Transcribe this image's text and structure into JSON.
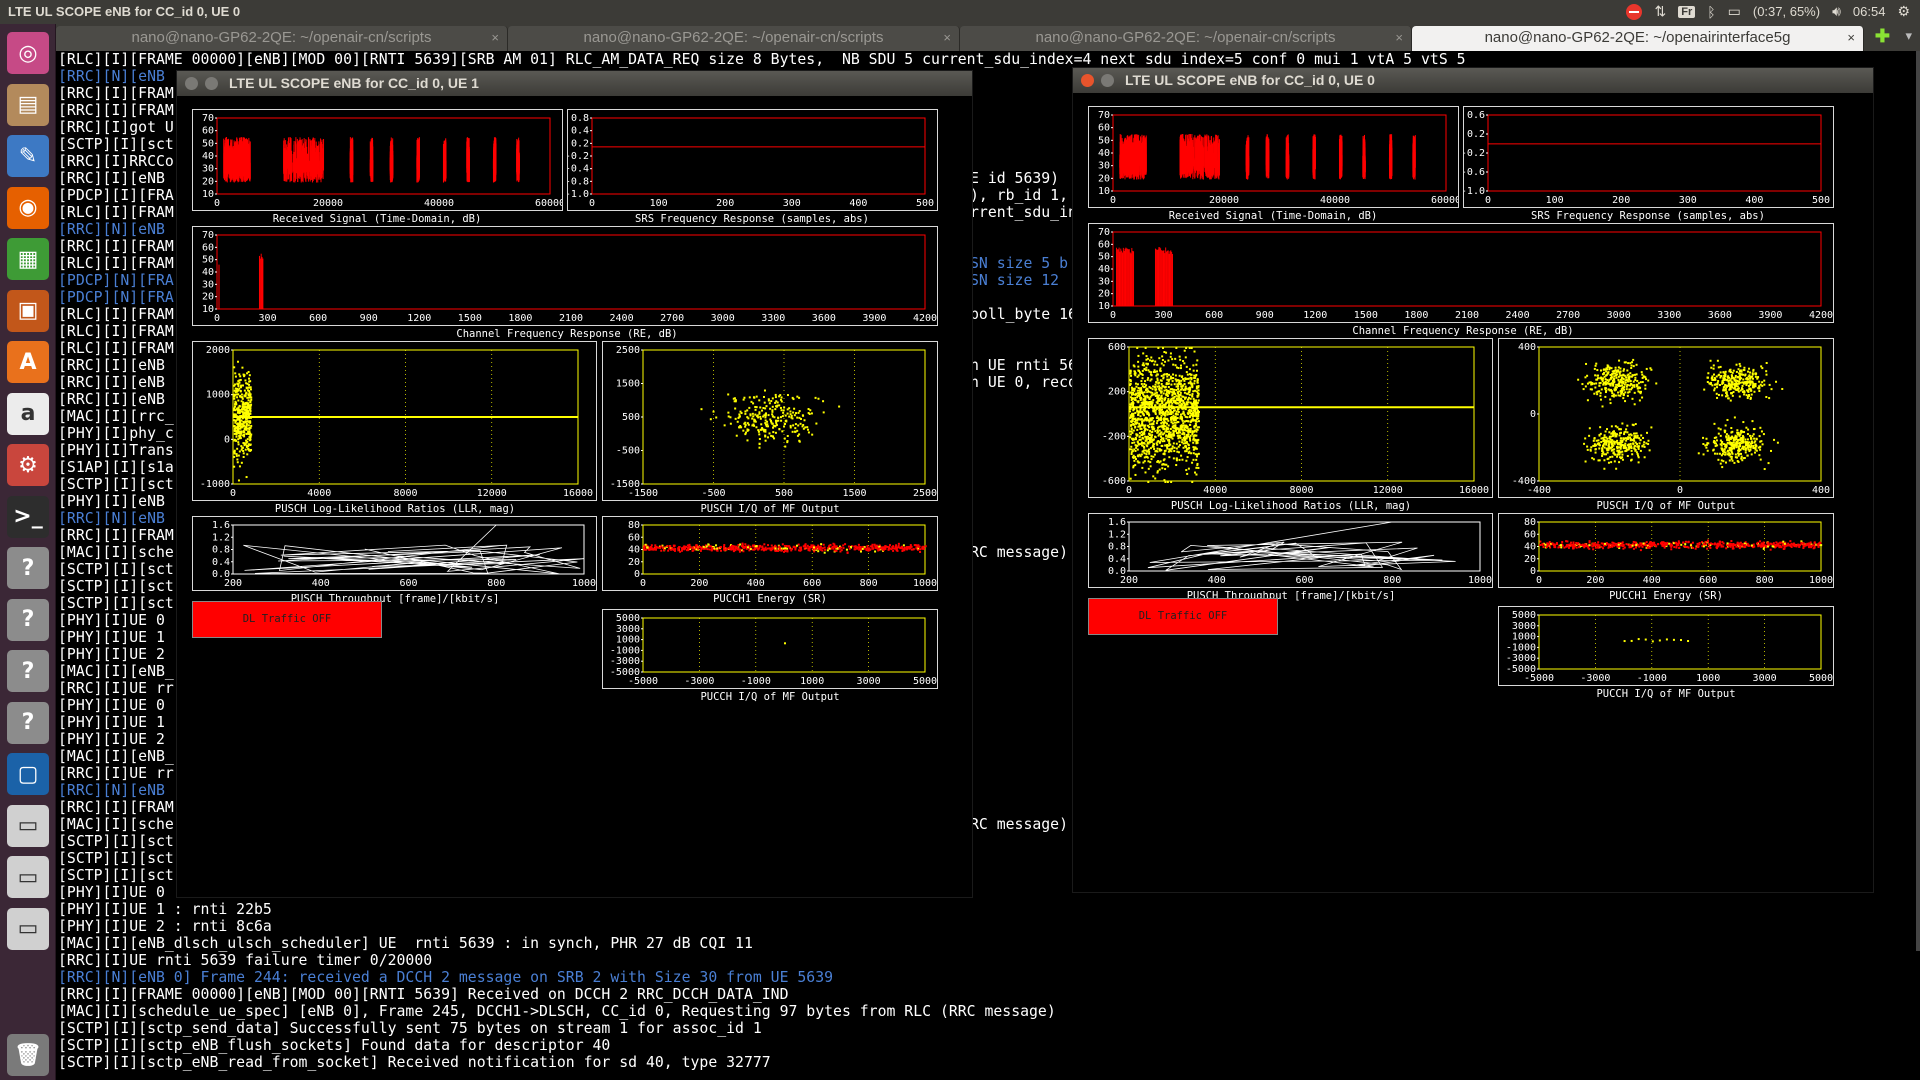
{
  "topbar": {
    "title": "LTE UL SCOPE eNB for CC_id 0, UE 0",
    "keyboard": "Fr",
    "battery": "(0:37, 65%)",
    "time": "06:54"
  },
  "launcher": {
    "items": [
      "ubuntu-dash",
      "file-manager",
      "text-editor",
      "firefox",
      "calc",
      "impress",
      "software-center",
      "amazon",
      "system-settings",
      "terminal",
      "unknown-app",
      "unknown-app",
      "unknown-app",
      "unknown-app",
      "virtualbox",
      "drive",
      "drive",
      "drive",
      "trash"
    ]
  },
  "tabs": [
    {
      "label": "nano@nano-GP62-2QE: ~/openair-cn/scripts",
      "active": false
    },
    {
      "label": "nano@nano-GP62-2QE: ~/openair-cn/scripts",
      "active": false
    },
    {
      "label": "nano@nano-GP62-2QE: ~/openair-cn/scripts",
      "active": false
    },
    {
      "label": "nano@nano-GP62-2QE: ~/openairinterface5g",
      "active": true
    }
  ],
  "terminal": {
    "lines": [
      {
        "t": "[RLC][I][FRAME 00000][eNB][MOD 00][RNTI 5639][SRB AM 01] RLC_AM_DATA_REQ size 8 Bytes,  NB SDU 5 current_sdu_index=4 next_sdu_index=5 conf 0 mui 1 vtA 5 vtS 5",
        "c": "w"
      },
      {
        "t": "[RRC][N][eNB",
        "c": "b"
      },
      {
        "t": "[RRC][I][FRAM",
        "c": "w"
      },
      {
        "t": "[RRC][I][FRAM",
        "c": "w"
      },
      {
        "t": "[RRC][I]got U",
        "c": "w"
      },
      {
        "t": "[SCTP][I][sct",
        "c": "w"
      },
      {
        "t": "[RRC][I]RRCCo",
        "c": "w"
      },
      {
        "t": "[RRC][I][eNB",
        "c": "w"
      },
      {
        "t": "[PDCP][I][FRA",
        "c": "w"
      },
      {
        "t": "[RLC][I][FRAM",
        "c": "w"
      },
      {
        "t": "[RRC][N][eNB",
        "c": "b"
      },
      {
        "t": "[RRC][I][FRAM",
        "c": "w"
      },
      {
        "t": "[RLC][I][FRAM",
        "c": "w"
      },
      {
        "t": "[PDCP][N][FRA",
        "c": "b"
      },
      {
        "t": "[PDCP][N][FRA",
        "c": "b"
      },
      {
        "t": "[RLC][I][FRAM",
        "c": "w"
      },
      {
        "t": "[RLC][I][FRAM",
        "c": "w"
      },
      {
        "t": "[RLC][I][FRAM",
        "c": "w"
      },
      {
        "t": "[RRC][I][eNB",
        "c": "w"
      },
      {
        "t": "[RRC][I][eNB",
        "c": "w"
      },
      {
        "t": "[RRC][I][eNB",
        "c": "w"
      },
      {
        "t": "[MAC][I][rrc_",
        "c": "w"
      },
      {
        "t": "[PHY][I]phy_c",
        "c": "w"
      },
      {
        "t": "[PHY][I]Trans",
        "c": "w"
      },
      {
        "t": "[S1AP][I][s1a",
        "c": "w"
      },
      {
        "t": "[SCTP][I][sct",
        "c": "w"
      },
      {
        "t": "[PHY][I][eNB",
        "c": "w"
      },
      {
        "t": "[RRC][N][eNB",
        "c": "b"
      },
      {
        "t": "[RRC][I][FRAM",
        "c": "w"
      },
      {
        "t": "[MAC][I][sche",
        "c": "w"
      },
      {
        "t": "[SCTP][I][sct",
        "c": "w"
      },
      {
        "t": "[SCTP][I][sct",
        "c": "w"
      },
      {
        "t": "[SCTP][I][sct",
        "c": "w"
      },
      {
        "t": "[PHY][I]UE 0",
        "c": "w"
      },
      {
        "t": "[PHY][I]UE 1",
        "c": "w"
      },
      {
        "t": "[PHY][I]UE 2",
        "c": "w"
      },
      {
        "t": "[MAC][I][eNB_",
        "c": "w"
      },
      {
        "t": "[RRC][I]UE rr",
        "c": "w"
      },
      {
        "t": "[PHY][I]UE 0",
        "c": "w"
      },
      {
        "t": "[PHY][I]UE 1",
        "c": "w"
      },
      {
        "t": "[PHY][I]UE 2",
        "c": "w"
      },
      {
        "t": "[MAC][I][eNB_",
        "c": "w"
      },
      {
        "t": "[RRC][I]UE rr",
        "c": "w"
      },
      {
        "t": "[RRC][N][eNB",
        "c": "b"
      },
      {
        "t": "[RRC][I][FRAM",
        "c": "w"
      },
      {
        "t": "[MAC][I][sche",
        "c": "w"
      },
      {
        "t": "[SCTP][I][sct",
        "c": "w"
      },
      {
        "t": "[SCTP][I][sct",
        "c": "w"
      },
      {
        "t": "[SCTP][I][sct",
        "c": "w"
      },
      {
        "t": "[PHY][I]UE 0 : rnti 5639",
        "c": "w"
      },
      {
        "t": "[PHY][I]UE 1 : rnti 22b5",
        "c": "w"
      },
      {
        "t": "[PHY][I]UE 2 : rnti 8c6a",
        "c": "w"
      },
      {
        "t": "[MAC][I][eNB_dlsch_ulsch_scheduler] UE  rnti 5639 : in synch, PHR 27 dB CQI 11",
        "c": "w"
      },
      {
        "t": "[RRC][I]UE rnti 5639 failure timer 0/20000",
        "c": "w"
      },
      {
        "t": "[RRC][N][eNB 0] Frame 244: received a DCCH 2 message on SRB 2 with Size 30 from UE 5639",
        "c": "b"
      },
      {
        "t": "[RRC][I][FRAME 00000][eNB][MOD 00][RNTI 5639] Received on DCCH 2 RRC_DCCH_DATA_IND",
        "c": "w"
      },
      {
        "t": "[MAC][I][schedule_ue_spec] [eNB 0], Frame 245, DCCH1->DLSCH, CC_id 0, Requesting 97 bytes from RLC (RRC message)",
        "c": "w"
      },
      {
        "t": "[SCTP][I][sctp_send_data] Successfully sent 75 bytes on stream 1 for assoc_id 1",
        "c": "w"
      },
      {
        "t": "[SCTP][I][sctp_eNB_flush_sockets] Found data for descriptor 40",
        "c": "w"
      },
      {
        "t": "[SCTP][I][sctp_eNB_read_from_socket] Received notification for sd 40, type 32777",
        "c": "w"
      }
    ],
    "fragments": [
      {
        "line": 7,
        "t": "E id 5639)"
      },
      {
        "line": 8,
        "t": "), rb_id 1,"
      },
      {
        "line": 9,
        "t": "rrent_sdu_in"
      },
      {
        "line": 12,
        "t": "SN size 5 b",
        "c": "b"
      },
      {
        "line": 13,
        "t": "SN size 12",
        "c": "b"
      },
      {
        "line": 15,
        "t": "poll_byte 16"
      },
      {
        "line": 18,
        "t": "n UE rnti 56"
      },
      {
        "line": 19,
        "t": "n UE 0, reco"
      },
      {
        "line": 29,
        "t": "RC message)"
      },
      {
        "line": 45,
        "t": "RC message)"
      }
    ]
  },
  "scopes": [
    {
      "title": "LTE UL SCOPE eNB for CC_id 0, UE 1",
      "captions": [
        "Received Signal (Time-Domain, dB)",
        "SRS Frequency Response (samples, abs)",
        "Channel Frequency  Response (RE, dB)",
        "PUSCH Log-Likelihood Ratios (LLR, mag)",
        "PUSCH I/Q of MF Output",
        "PUSCH Throughput [frame]/[kbit/s]",
        "PUCCH1 Energy (SR)",
        "PUCCH I/Q of MF Output"
      ],
      "button": "DL Traffic OFF",
      "ticks": {
        "rx_y": [
          "70",
          "60",
          "50",
          "40",
          "30",
          "20",
          "10"
        ],
        "rx_x": [
          "0",
          "20000",
          "40000",
          "60000"
        ],
        "srs_y": [
          "0.8",
          "0.4",
          "0.2",
          "-0.2",
          "-0.4",
          "-0.8",
          "-1.0"
        ],
        "srs_x": [
          "0",
          "100",
          "200",
          "300",
          "400",
          "500"
        ],
        "ch_y": [
          "70",
          "60",
          "50",
          "40",
          "30",
          "20",
          "10"
        ],
        "ch_x": [
          "0",
          "300",
          "600",
          "900",
          "1200",
          "1500",
          "1800",
          "2100",
          "2400",
          "2700",
          "3000",
          "3300",
          "3600",
          "3900",
          "4200"
        ],
        "llr_y": [
          "2000",
          "1000",
          "0",
          "-1000"
        ],
        "llr_x": [
          "0",
          "4000",
          "8000",
          "12000",
          "16000"
        ],
        "iq_y": [
          "2500",
          "1500",
          "500",
          "-500",
          "-1500"
        ],
        "iq_x": [
          "-1500",
          "-500",
          "500",
          "1500",
          "2500"
        ],
        "thr_y": [
          "1.6",
          "1.2",
          "0.8",
          "0.4",
          "0.0"
        ],
        "thr_x": [
          "200",
          "400",
          "600",
          "800",
          "1000"
        ],
        "pe_y": [
          "80",
          "60",
          "40",
          "20",
          "0"
        ],
        "pe_x": [
          "0",
          "200",
          "400",
          "600",
          "800",
          "1000"
        ],
        "piq_y": [
          "5000",
          "3000",
          "1000",
          "-1000",
          "-3000",
          "-5000"
        ],
        "piq_x": [
          "-5000",
          "-3000",
          "-1000",
          "1000",
          "3000",
          "5000"
        ]
      }
    },
    {
      "title": "LTE UL SCOPE eNB for CC_id 0, UE 0",
      "captions": [
        "Received Signal (Time-Domain, dB)",
        "SRS Frequency Response (samples, abs)",
        "Channel Frequency  Response (RE, dB)",
        "PUSCH Log-Likelihood Ratios (LLR, mag)",
        "PUSCH I/Q of MF Output",
        "PUSCH Throughput [frame]/[kbit/s]",
        "PUCCH1 Energy (SR)",
        "PUCCH I/Q of MF Output"
      ],
      "button": "DL Traffic OFF",
      "ticks": {
        "rx_y": [
          "70",
          "60",
          "50",
          "40",
          "30",
          "20",
          "10"
        ],
        "rx_x": [
          "0",
          "20000",
          "40000",
          "60000"
        ],
        "srs_y": [
          "0.6",
          "0.2",
          "-0.2",
          "-0.6",
          "-1.0"
        ],
        "srs_x": [
          "0",
          "100",
          "200",
          "300",
          "400",
          "500"
        ],
        "ch_y": [
          "70",
          "60",
          "50",
          "40",
          "30",
          "20",
          "10"
        ],
        "ch_x": [
          "0",
          "300",
          "600",
          "900",
          "1200",
          "1500",
          "1800",
          "2100",
          "2400",
          "2700",
          "3000",
          "3300",
          "3600",
          "3900",
          "4200"
        ],
        "llr_y": [
          "600",
          "200",
          "-200",
          "-600"
        ],
        "llr_x": [
          "0",
          "4000",
          "8000",
          "12000",
          "16000"
        ],
        "iq_y": [
          "400",
          "0",
          "-400"
        ],
        "iq_x": [
          "-400",
          "0",
          "400"
        ],
        "thr_y": [
          "1.6",
          "1.2",
          "0.8",
          "0.4",
          "0.0"
        ],
        "thr_x": [
          "200",
          "400",
          "600",
          "800",
          "1000"
        ],
        "pe_y": [
          "80",
          "60",
          "40",
          "20",
          "0"
        ],
        "pe_x": [
          "0",
          "200",
          "400",
          "600",
          "800",
          "1000"
        ],
        "piq_y": [
          "5000",
          "3000",
          "1000",
          "-1000",
          "-3000",
          "-5000"
        ],
        "piq_x": [
          "-5000",
          "-3000",
          "-1000",
          "1000",
          "3000",
          "5000"
        ]
      }
    }
  ],
  "colors": {
    "signal": "#ff0000",
    "llr": "#ffff00",
    "frame": "#ff0000",
    "grid": "#ffff00"
  }
}
